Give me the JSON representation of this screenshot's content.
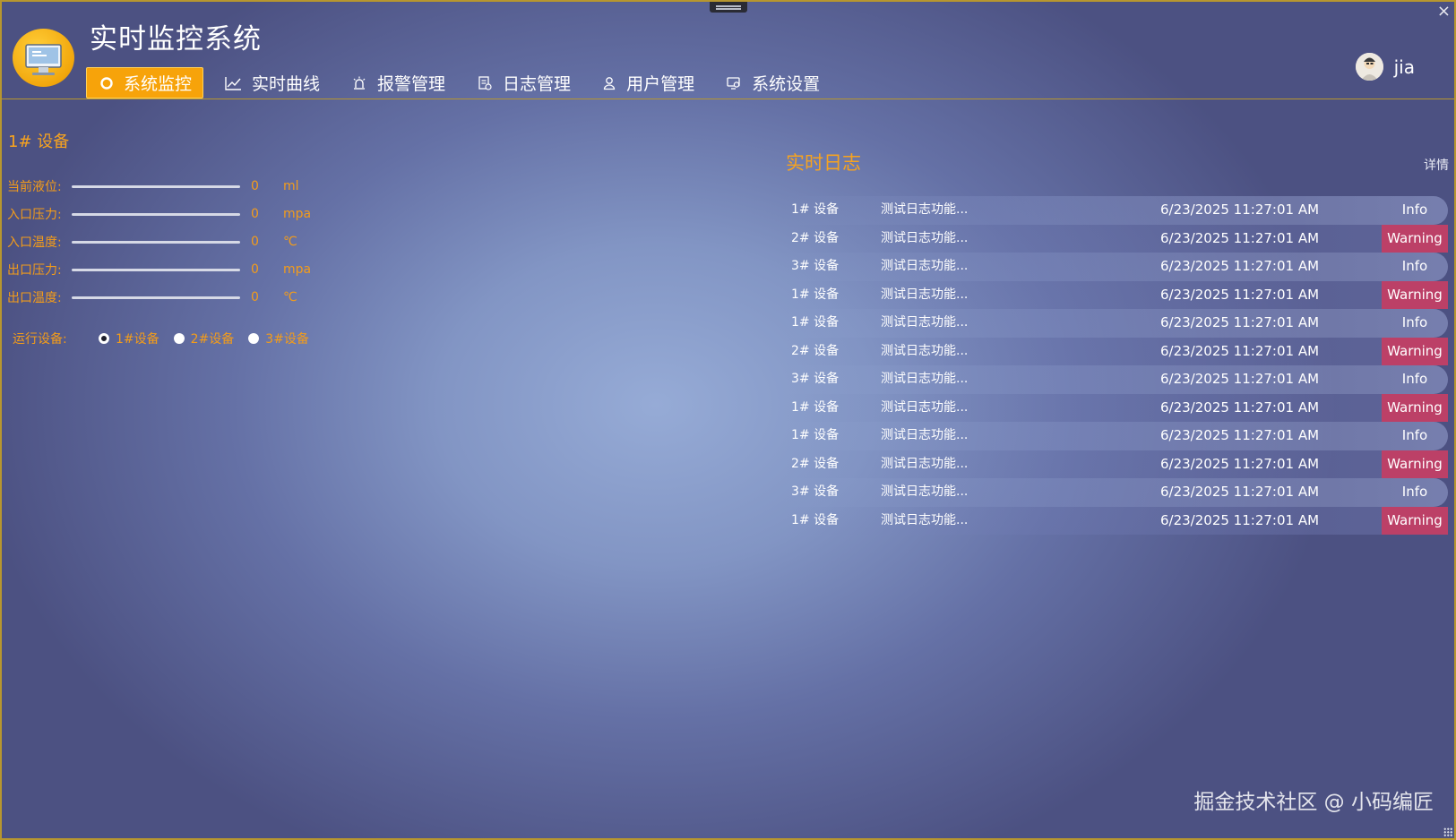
{
  "window": {
    "close_label": "×"
  },
  "header": {
    "title": "实时监控系统",
    "user_name": "jia",
    "nav": [
      {
        "label": "系统监控",
        "icon": "circle-icon",
        "active": true
      },
      {
        "label": "实时曲线",
        "icon": "line-chart-icon",
        "active": false
      },
      {
        "label": "报警管理",
        "icon": "alarm-icon",
        "active": false
      },
      {
        "label": "日志管理",
        "icon": "log-icon",
        "active": false
      },
      {
        "label": "用户管理",
        "icon": "user-icon",
        "active": false
      },
      {
        "label": "系统设置",
        "icon": "settings-icon",
        "active": false
      }
    ]
  },
  "device": {
    "title": "1# 设备",
    "params": [
      {
        "label": "当前液位:",
        "value": "0",
        "unit": "ml",
        "level": 0
      },
      {
        "label": "入口压力:",
        "value": "0",
        "unit": "mpa",
        "level": 0
      },
      {
        "label": "入口温度:",
        "value": "0",
        "unit": "℃",
        "level": 0
      },
      {
        "label": "出口压力:",
        "value": "0",
        "unit": "mpa",
        "level": 0
      },
      {
        "label": "出口温度:",
        "value": "0",
        "unit": "℃",
        "level": 0
      }
    ],
    "run_label": "运行设备:",
    "run_options": [
      {
        "label": "1#设备",
        "checked": true
      },
      {
        "label": "2#设备",
        "checked": false
      },
      {
        "label": "3#设备",
        "checked": false
      }
    ]
  },
  "log": {
    "title": "实时日志",
    "detail_label": "详情",
    "rows": [
      {
        "device": "1# 设备",
        "message": "测试日志功能...",
        "time": "6/23/2025 11:27:01 AM",
        "level": "Info"
      },
      {
        "device": "2# 设备",
        "message": "测试日志功能...",
        "time": "6/23/2025 11:27:01 AM",
        "level": "Warning"
      },
      {
        "device": "3# 设备",
        "message": "测试日志功能...",
        "time": "6/23/2025 11:27:01 AM",
        "level": "Info"
      },
      {
        "device": "1# 设备",
        "message": "测试日志功能...",
        "time": "6/23/2025 11:27:01 AM",
        "level": "Warning"
      },
      {
        "device": "1# 设备",
        "message": "测试日志功能...",
        "time": "6/23/2025 11:27:01 AM",
        "level": "Info"
      },
      {
        "device": "2# 设备",
        "message": "测试日志功能...",
        "time": "6/23/2025 11:27:01 AM",
        "level": "Warning"
      },
      {
        "device": "3# 设备",
        "message": "测试日志功能...",
        "time": "6/23/2025 11:27:01 AM",
        "level": "Info"
      },
      {
        "device": "1# 设备",
        "message": "测试日志功能...",
        "time": "6/23/2025 11:27:01 AM",
        "level": "Warning"
      },
      {
        "device": "1# 设备",
        "message": "测试日志功能...",
        "time": "6/23/2025 11:27:01 AM",
        "level": "Info"
      },
      {
        "device": "2# 设备",
        "message": "测试日志功能...",
        "time": "6/23/2025 11:27:01 AM",
        "level": "Warning"
      },
      {
        "device": "3# 设备",
        "message": "测试日志功能...",
        "time": "6/23/2025 11:27:01 AM",
        "level": "Info"
      },
      {
        "device": "1# 设备",
        "message": "测试日志功能...",
        "time": "6/23/2025 11:27:01 AM",
        "level": "Warning"
      }
    ]
  },
  "watermark": "掘金技术社区 @ 小码编匠",
  "colors": {
    "accent": "#f7a30a",
    "label": "#f39c1a",
    "warning": "#bc4067",
    "border": "#b7962f"
  }
}
